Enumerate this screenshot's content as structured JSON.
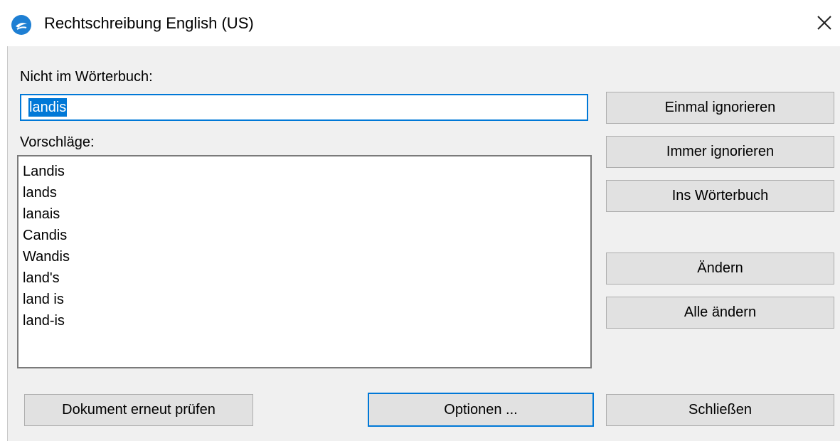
{
  "window": {
    "title": "Rechtschreibung English (US)",
    "close_label": "×"
  },
  "not_in_dict": {
    "label": "Nicht im Wörterbuch:",
    "value": "landis"
  },
  "suggestions": {
    "label": "Vorschläge:",
    "items": [
      "Landis",
      "lands",
      "lanais",
      "Candis",
      "Wandis",
      "land's",
      "land is",
      "land-is"
    ]
  },
  "buttons": {
    "ignore_once": "Einmal ignorieren",
    "ignore_all": "Immer ignorieren",
    "add_to_dict": "Ins Wörterbuch",
    "change": "Ändern",
    "change_all": "Alle ändern",
    "recheck": "Dokument erneut prüfen",
    "options": "Optionen ...",
    "close": "Schließen"
  },
  "colors": {
    "accent": "#0078d7",
    "dialog_bg": "#f0f0f0",
    "button_bg": "#e1e1e1"
  }
}
